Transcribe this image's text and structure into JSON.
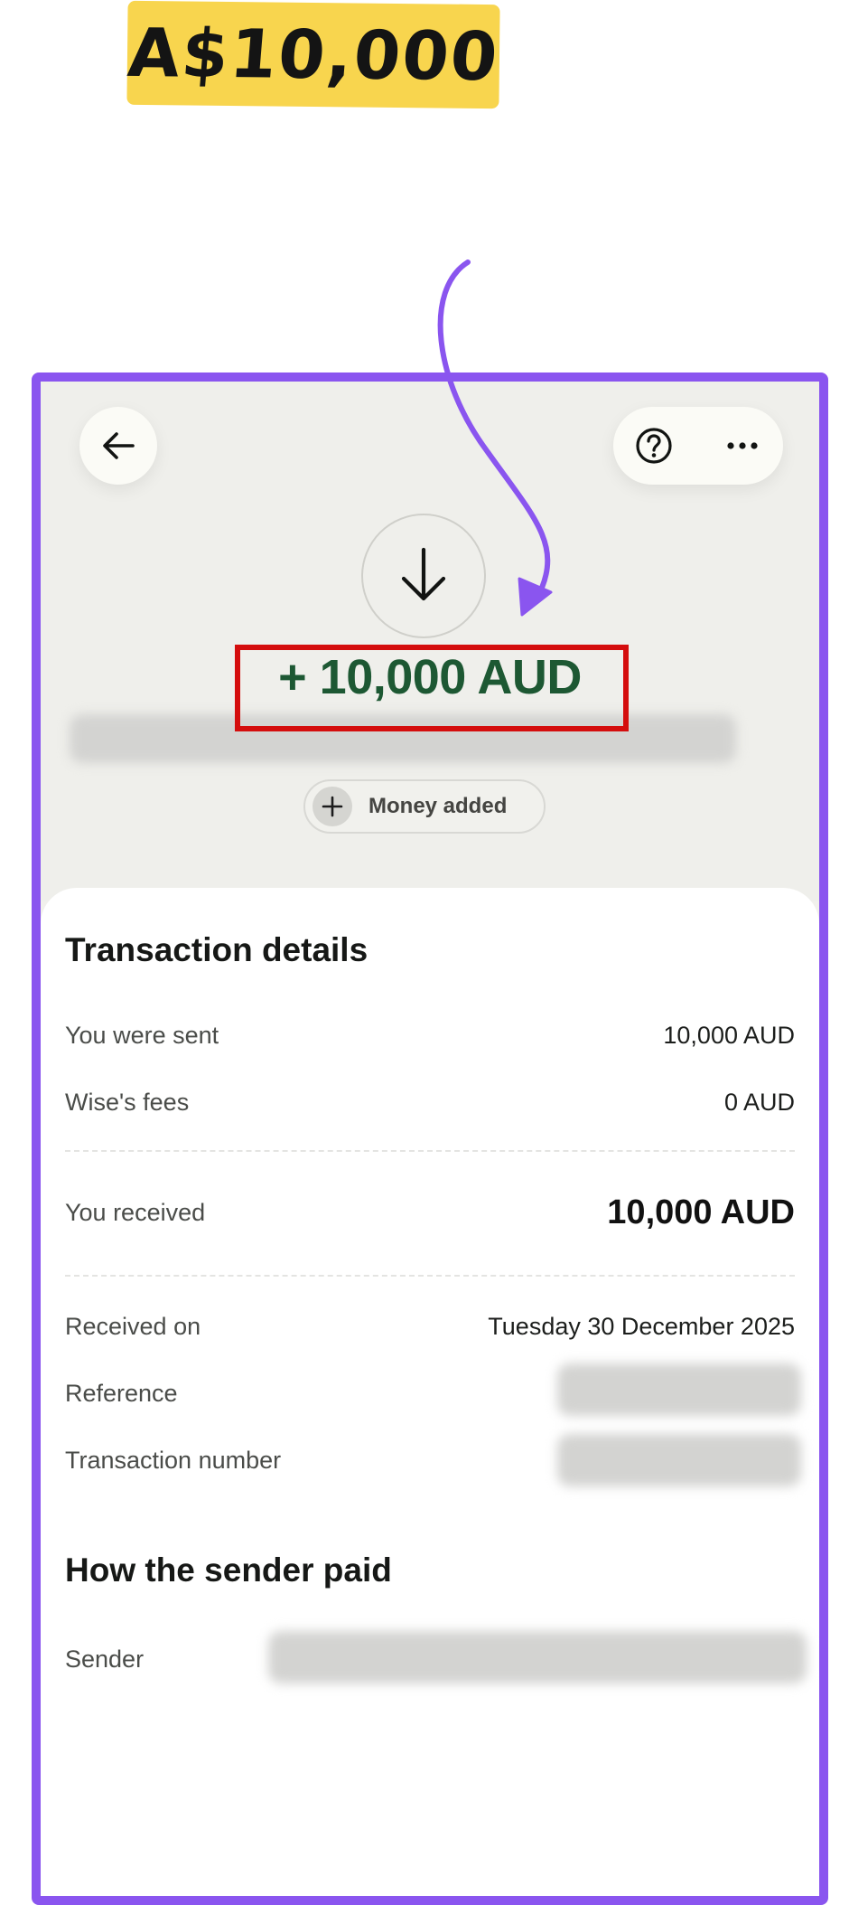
{
  "annotation": {
    "badge_text": "A$10,000",
    "arrow_color": "#8a55ef",
    "highlight_color": "#d40d0d",
    "frame_color": "#8a55ef"
  },
  "header": {
    "back_icon": "arrow-left-icon",
    "help_icon": "help-circle-icon",
    "more_icon": "more-horizontal-icon"
  },
  "transaction": {
    "direction_icon": "arrow-down-icon",
    "amount": "+ 10,000 AUD",
    "status_chip": {
      "icon": "plus-icon",
      "label": "Money added"
    }
  },
  "details": {
    "title": "Transaction details",
    "sent_label": "You were sent",
    "sent_value": "10,000 AUD",
    "fees_label": "Wise's fees",
    "fees_value": "0 AUD",
    "received_label": "You received",
    "received_value": "10,000 AUD",
    "received_on_label": "Received on",
    "received_on_value": "Tuesday 30 December 2025",
    "reference_label": "Reference",
    "transaction_number_label": "Transaction number"
  },
  "sender_section": {
    "title": "How the sender paid",
    "sender_label": "Sender"
  }
}
